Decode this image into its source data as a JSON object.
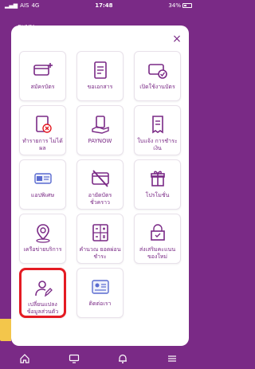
{
  "status": {
    "carrier": "AIS",
    "network": "4G",
    "time": "17:48",
    "battery": "34%"
  },
  "header": {
    "title": "ระบบ"
  },
  "menu": {
    "close_label": "×",
    "tiles": [
      {
        "label": "สมัครบัตร",
        "icon": "card-plus-icon"
      },
      {
        "label": "ขอเอกสาร",
        "icon": "document-icon"
      },
      {
        "label": "เปิดใช้งานบัตร",
        "icon": "card-check-icon"
      },
      {
        "label": "ทำรายการ ไม่ได้ผล",
        "icon": "document-x-icon"
      },
      {
        "label": "PAYNOW",
        "icon": "hand-pay-icon"
      },
      {
        "label": "ใบแจ้ง การชำระเงิน",
        "icon": "receipt-icon"
      },
      {
        "label": "แอปพิเศษ",
        "icon": "app-plan-icon"
      },
      {
        "label": "อายัดบัตร ชั่วคราว",
        "icon": "card-block-icon"
      },
      {
        "label": "โปรโมชั่น",
        "icon": "gift-icon"
      },
      {
        "label": "เครือข่ายบริการ",
        "icon": "location-person-icon"
      },
      {
        "label": "คำนวณ ยอดผ่อนชำระ",
        "icon": "calculator-icon"
      },
      {
        "label": "ส่งเสริมคะแนน ของใหม่",
        "icon": "gift-bag-icon"
      },
      {
        "label": "เปลี่ยนแปลง ข้อมูลส่วนตัว",
        "icon": "person-edit-icon",
        "highlight": true
      },
      {
        "label": "ติดต่อเรา",
        "icon": "contact-card-icon"
      }
    ]
  },
  "colors": {
    "brand": "#7a2a86",
    "highlight": "#e41b23",
    "tile_border": "#e8e1ea"
  },
  "nav": [
    "home-icon",
    "desktop-icon",
    "bell-icon",
    "menu-icon"
  ]
}
